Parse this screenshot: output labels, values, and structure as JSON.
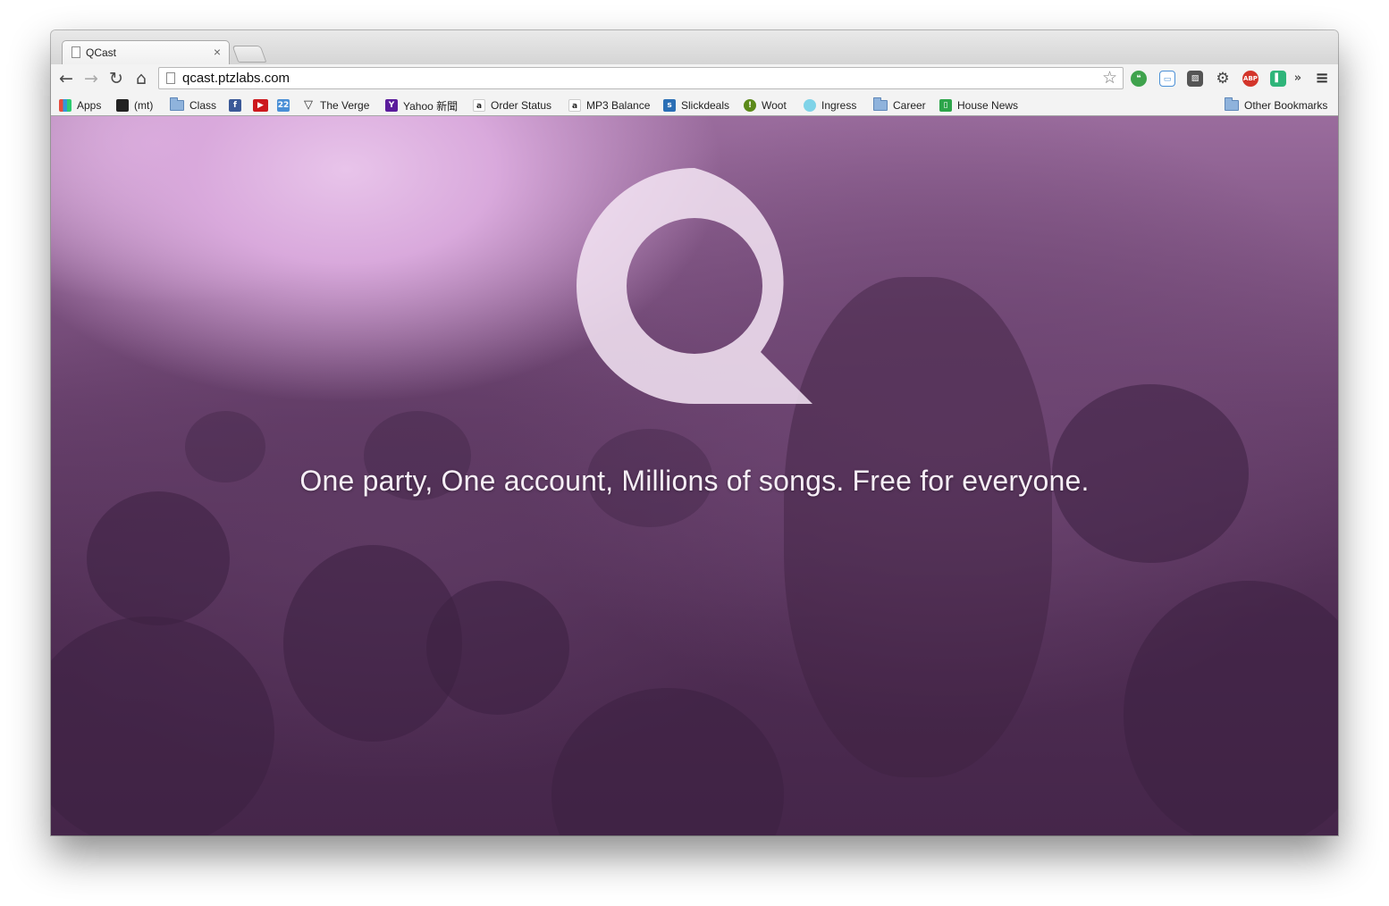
{
  "tab": {
    "title": "QCast",
    "close": "×"
  },
  "toolbar": {
    "back": "←",
    "forward": "→",
    "reload": "↻",
    "home": "⌂",
    "url": "qcast.ptzlabs.com",
    "star": "☆",
    "extensions": [
      {
        "name": "hangouts",
        "label": "❝",
        "color": "#3fa34d"
      },
      {
        "name": "cast",
        "label": "▭",
        "color": "#4a8fd6"
      },
      {
        "name": "readability",
        "label": "▨",
        "color": "#555555"
      },
      {
        "name": "settings",
        "label": "⚙",
        "color": "#444444"
      },
      {
        "name": "adblock",
        "label": "ABP",
        "color": "#d3352b"
      },
      {
        "name": "pushbullet",
        "label": "▌",
        "color": "#2fb57a"
      }
    ],
    "overflow": "»",
    "menu": "≡"
  },
  "bookmarks": {
    "items": [
      {
        "label": "Apps",
        "icon": "apps-grid-icon"
      },
      {
        "label": "(mt)",
        "icon": "mt-icon"
      },
      {
        "label": "Class",
        "icon": "folder-icon"
      },
      {
        "label": "",
        "icon": "facebook-icon"
      },
      {
        "label": "",
        "icon": "youtube-icon"
      },
      {
        "label": "",
        "icon": "calendar-icon"
      },
      {
        "label": "The Verge",
        "icon": "verge-icon"
      },
      {
        "label": "Yahoo 新聞",
        "icon": "yahoo-icon"
      },
      {
        "label": "Order Status",
        "icon": "amazon-icon"
      },
      {
        "label": "MP3 Balance",
        "icon": "amazon-icon"
      },
      {
        "label": "Slickdeals",
        "icon": "slickdeals-icon"
      },
      {
        "label": "Woot",
        "icon": "woot-icon"
      },
      {
        "label": "Ingress",
        "icon": "ingress-icon"
      },
      {
        "label": "Career",
        "icon": "folder-icon"
      },
      {
        "label": "House News",
        "icon": "house-news-icon"
      }
    ],
    "other": "Other Bookmarks",
    "calendar_day": "22"
  },
  "page": {
    "tagline": "One party, One account, Millions of songs. Free for everyone.",
    "logo": "q-logo",
    "accent": "#6a426e"
  }
}
